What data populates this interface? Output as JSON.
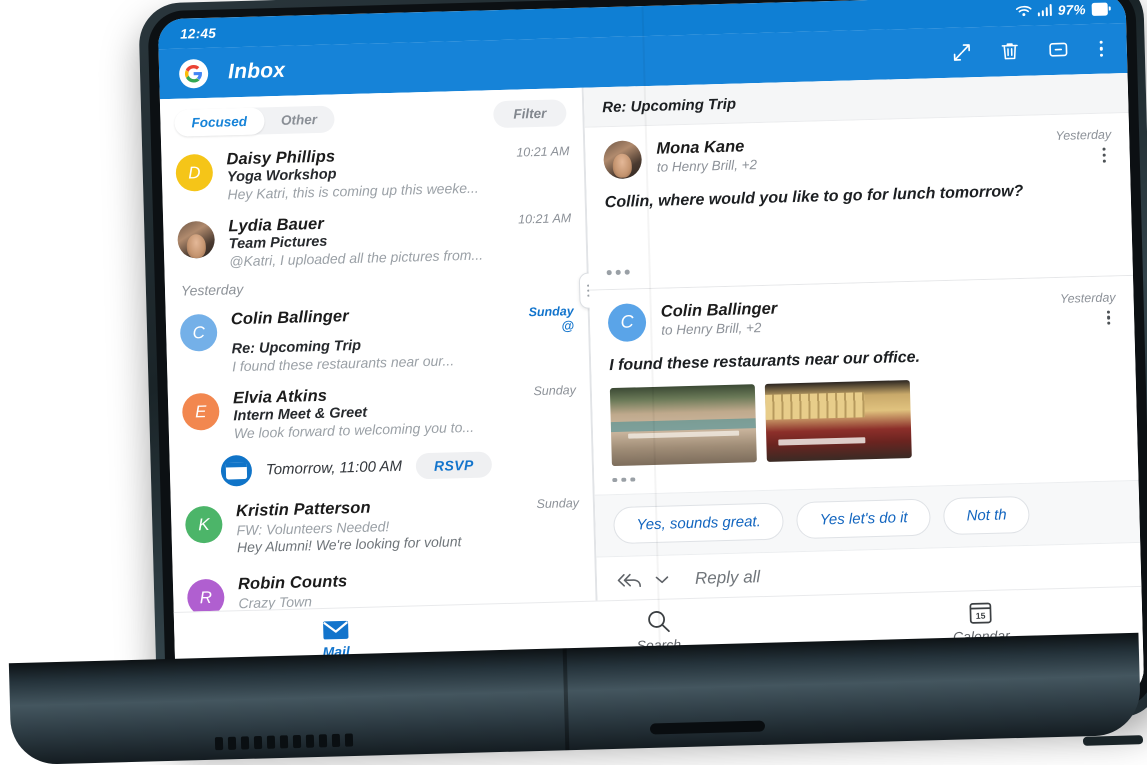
{
  "status_bar": {
    "time": "12:45",
    "battery_percent": "97%",
    "wifi_icon": "wifi-icon",
    "signal_icon": "signal-bars-icon",
    "battery_icon": "battery-icon"
  },
  "app_bar": {
    "title": "Inbox",
    "account_logo": "google-logo",
    "actions": [
      {
        "name": "expand-icon",
        "label": "Expand"
      },
      {
        "name": "delete-icon",
        "label": "Delete"
      },
      {
        "name": "archive-icon",
        "label": "Archive"
      },
      {
        "name": "more-options-icon",
        "label": "More options"
      }
    ]
  },
  "filter_row": {
    "tabs": [
      {
        "label": "Focused",
        "active": true
      },
      {
        "label": "Other",
        "active": false
      }
    ],
    "filter_label": "Filter"
  },
  "mail_list": {
    "items": [
      {
        "sender": "Daisy Phillips",
        "subject": "Yoga Workshop",
        "preview": "Hey Katri, this is coming up this weeke...",
        "time": "10:21 AM",
        "avatar_letter": "D",
        "avatar_color": "#f5c518"
      },
      {
        "sender": "Lydia Bauer",
        "subject": "Team Pictures",
        "preview": "@Katri, I uploaded all the pictures from...",
        "time": "10:21 AM",
        "avatar_letter": "",
        "avatar_color": ""
      },
      {
        "sender": "Colin Ballinger",
        "subject": "Re: Upcoming Trip",
        "preview": "I found these restaurants near our...",
        "time": "Sunday",
        "mention": "@",
        "avatar_letter": "C",
        "avatar_color": "#74b0e8"
      },
      {
        "sender": "Elvia Atkins",
        "subject": "Intern Meet & Greet",
        "preview": "We look forward to welcoming you to...",
        "time": "Sunday",
        "avatar_letter": "E",
        "avatar_color": "#f2874f"
      },
      {
        "sender": "Kristin Patterson",
        "subject": "FW: Volunteers Needed!",
        "preview": "Hey Alumni! We're looking for volunt",
        "time": "Sunday",
        "avatar_letter": "K",
        "avatar_color": "#4cb569"
      },
      {
        "sender": "Robin Counts",
        "subject": "Crazy Town",
        "preview": "",
        "time": "",
        "avatar_letter": "R",
        "avatar_color": "#b05fd0"
      }
    ],
    "day_divider": "Yesterday",
    "rsvp": {
      "when": "Tomorrow, 11:00 AM",
      "button": "RSVP",
      "icon": "calendar-event-icon"
    },
    "compose_icon": "compose-icon"
  },
  "reading_pane": {
    "thread_title": "Re: Upcoming Trip",
    "messages": [
      {
        "sender": "Mona Kane",
        "recipients": "to Henry Brill, +2",
        "date": "Yesterday",
        "body": "Collin, where would  you like to go for lunch tomorrow?",
        "avatar_letter": "",
        "avatar_color": ""
      },
      {
        "sender": "Colin Ballinger",
        "recipients": "to Henry Brill, +2",
        "date": "Yesterday",
        "body": "I found these restaurants near our office.",
        "avatar_letter": "C",
        "avatar_color": "#5aa4e8"
      }
    ],
    "quick_replies": [
      "Yes, sounds great.",
      "Yes let's do it",
      "Not th"
    ],
    "reply_bar": {
      "label": "Reply all",
      "icon": "reply-all-icon",
      "chevron": "chevron-down-icon"
    }
  },
  "bottom_tabs": [
    {
      "label": "Mail",
      "icon": "mail-icon",
      "active": true
    },
    {
      "label": "Search",
      "icon": "search-icon",
      "active": false
    },
    {
      "label": "Calendar",
      "icon": "calendar-icon",
      "active": false,
      "day_number": "15"
    }
  ],
  "android_dock": {
    "app_drawer_icon": "app-grid-icon",
    "apps": [
      {
        "name": "outlook-app-icon",
        "color": "#0f6cbd"
      },
      {
        "name": "messages-app-icon",
        "color": "#1877e8"
      },
      {
        "name": "samsung-internet-icon",
        "color": "#7d6ce8"
      },
      {
        "name": "notes-app-icon",
        "color": "#f06a12"
      },
      {
        "name": "gallery-app-icon",
        "color": "#d4136e"
      },
      {
        "name": "camera-app-icon",
        "color": "#f0156b"
      }
    ],
    "nav": [
      "recents-button",
      "home-button",
      "back-button"
    ]
  },
  "colors": {
    "accent": "#1683d8",
    "status_bar": "#0f7fd4",
    "link": "#1274cc"
  }
}
